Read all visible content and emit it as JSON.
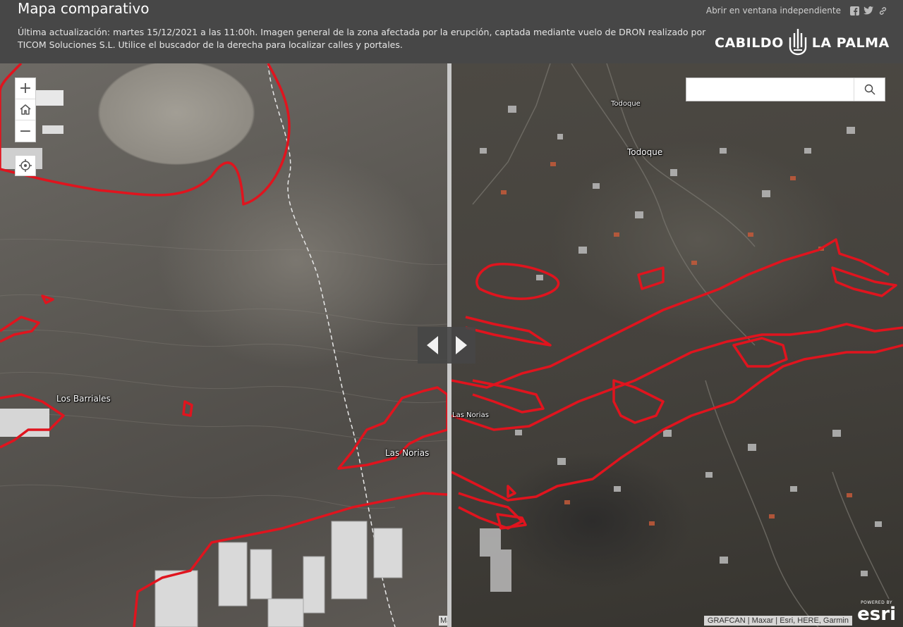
{
  "header": {
    "title": "Mapa comparativo",
    "subtitle": "Última actualización: martes 15/12/2021 a las 11:00h. Imagen general de la zona afectada por la erupción, captada mediante vuelo de DRON realizado por TICOM Soluciones S.L. Utilice el buscador de la derecha para localizar calles y portales.",
    "share_label": "Abrir en ventana independiente",
    "logo_left": "CABILDO",
    "logo_right": "LA PALMA"
  },
  "map": {
    "controls": {
      "zoom_in": "+",
      "zoom_out": "−"
    },
    "search": {
      "placeholder": "",
      "value": ""
    },
    "places": {
      "todoque_small": "Todoque",
      "todoque": "Todoque",
      "los_barriales": "Los Barriales",
      "las_norias": "Las Norias",
      "las_norias_right": "Las Norias"
    },
    "attribution": "GRAFCAN | Maxar | Esri, HERE, Garmin",
    "attribution_left": "Ma",
    "esri_powered": "POWERED BY",
    "esri_logo": "esri",
    "colors": {
      "lava_outline": "#e0141e",
      "header_bg": "#474747"
    }
  }
}
